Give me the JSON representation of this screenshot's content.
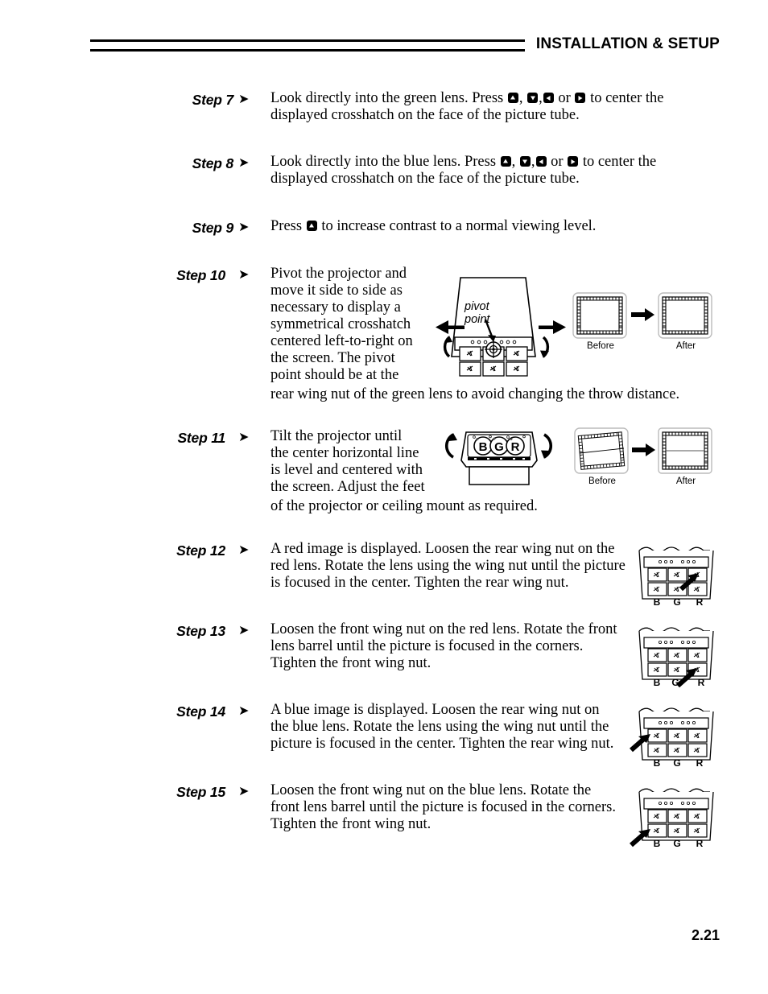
{
  "header": {
    "title": "INSTALLATION & SETUP"
  },
  "page_number": "2.21",
  "keys": {
    "up": "up-arrow-key",
    "down": "down-arrow-key",
    "left": "left-arrow-key",
    "right": "right-arrow-key"
  },
  "steps": [
    {
      "label": "Step 7",
      "arrow": "➤",
      "text_before_keys": "Look directly into the green lens. Press ",
      "text_mid_1": ", ",
      "text_mid_2": ",",
      "text_mid_3": " or ",
      "text_after_keys": " to center the displayed crosshatch on the face of the picture tube."
    },
    {
      "label": "Step 8",
      "arrow": "➤",
      "text_before_keys": "Look directly into the blue lens. Press ",
      "text_mid_1": ", ",
      "text_mid_2": ",",
      "text_mid_3": " or ",
      "text_after_keys": " to center the displayed crosshatch on the face of the picture tube."
    },
    {
      "label": "Step 9",
      "arrow": "➤",
      "text_before_keys": "Press ",
      "text_after_keys": " to increase contrast to a normal viewing level."
    },
    {
      "label": "Step 10",
      "arrow": "➤",
      "text_main": "Pivot the projector and move it side to side as necessary to display a symmetrical crosshatch centered left-to-right on the screen. The pivot",
      "text_wrap_1": "Pivot the projector and",
      "text_wrap_2": "move it side to side as",
      "text_wrap_3": "necessary to display a",
      "text_wrap_4": "symmetrical crosshatch",
      "text_wrap_5": "centered left-to-right on",
      "text_wrap_6": "the screen. The pivot",
      "text_wrap_7": "point should be at the",
      "text_full_width": "rear wing nut of the green lens to avoid changing the throw distance.",
      "figure": {
        "pivot_label_line1": "pivot",
        "pivot_label_line2": "point",
        "before_caption": "Before",
        "after_caption": "After"
      }
    },
    {
      "label": "Step 11",
      "arrow": "➤",
      "text_wrap_1": "Tilt the projector until",
      "text_wrap_2": "the center horizontal line",
      "text_wrap_3": "is level and centered with",
      "text_wrap_4": "the screen. Adjust the feet",
      "text_full_width": "of the projector or ceiling mount as required.",
      "figure": {
        "lens_b": "B",
        "lens_g": "G",
        "lens_r": "R",
        "before_caption": "Before",
        "after_caption": "After"
      }
    },
    {
      "label": "Step 12",
      "arrow": "➤",
      "text_wrap_1": "A red image is displayed. Loosen the rear wing nut on the",
      "text_wrap_2": "red lens. Rotate the lens using the wing nut until the picture",
      "text_wrap_3": "is focused in the center. Tighten the rear wing nut.",
      "figure": {
        "lens_b": "B",
        "lens_g": "G",
        "lens_r": "R",
        "arrow_target": "rear-wing-nut-red"
      }
    },
    {
      "label": "Step 13",
      "arrow": "➤",
      "text_wrap_1": "Loosen the front wing nut on the red lens. Rotate the front",
      "text_wrap_2": "lens barrel until the picture is focused in the corners.",
      "text_wrap_3": "Tighten the front wing nut.",
      "figure": {
        "lens_b": "B",
        "lens_g": "G",
        "lens_r": "R",
        "arrow_target": "front-wing-nut-red"
      }
    },
    {
      "label": "Step 14",
      "arrow": "➤",
      "text_wrap_1": "A blue image is displayed. Loosen the rear wing nut on",
      "text_wrap_2": "the blue lens. Rotate the lens using the wing nut until the",
      "text_wrap_3": "picture is focused in the center. Tighten the rear wing nut.",
      "figure": {
        "lens_b": "B",
        "lens_g": "G",
        "lens_r": "R",
        "arrow_target": "rear-wing-nut-blue"
      }
    },
    {
      "label": "Step 15",
      "arrow": "➤",
      "text_wrap_1": "Loosen the front wing nut on the blue lens. Rotate the",
      "text_wrap_2": "front lens barrel until the picture is focused in the corners.",
      "text_wrap_3": "Tighten the front wing nut.",
      "figure": {
        "lens_b": "B",
        "lens_g": "G",
        "lens_r": "R",
        "arrow_target": "front-wing-nut-blue"
      }
    }
  ]
}
